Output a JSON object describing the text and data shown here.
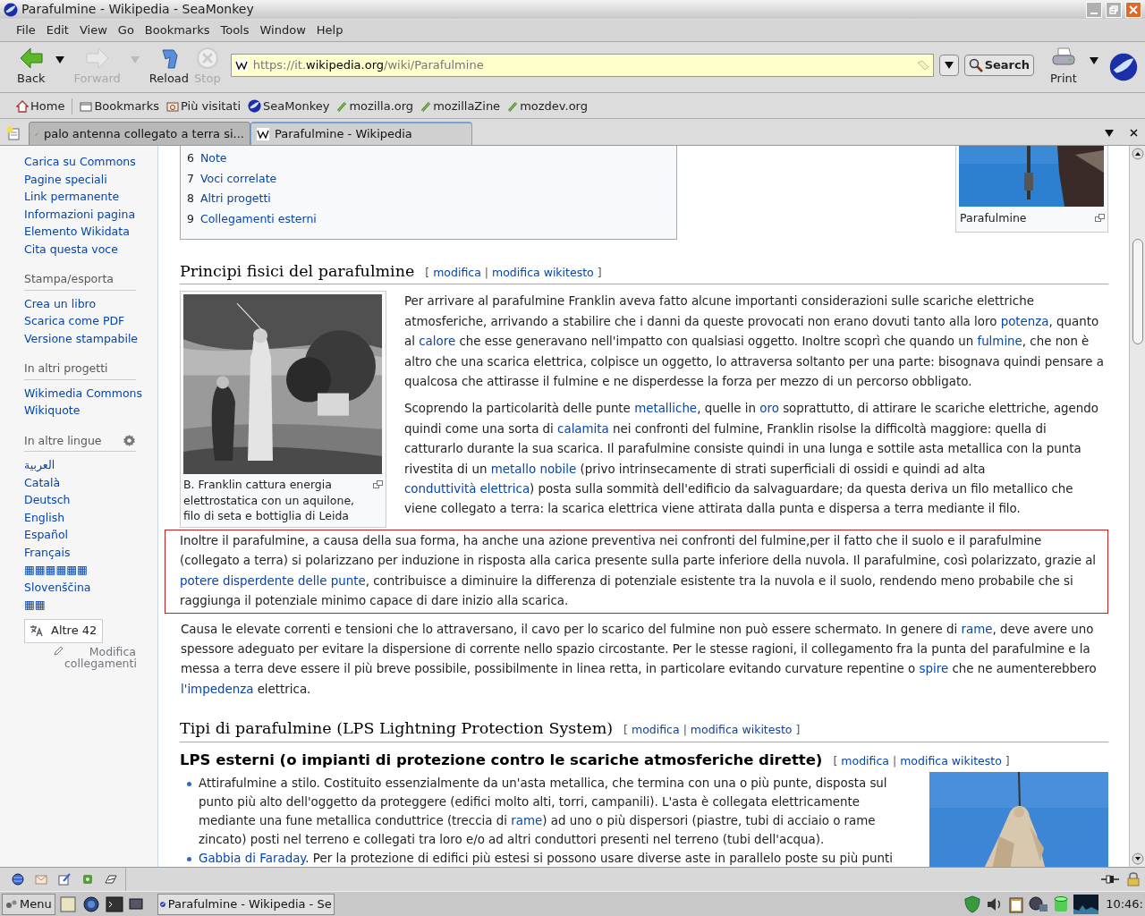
{
  "window": {
    "title": "Parafulmine - Wikipedia - SeaMonkey"
  },
  "menu": [
    "File",
    "Edit",
    "View",
    "Go",
    "Bookmarks",
    "Tools",
    "Window",
    "Help"
  ],
  "nav_buttons": [
    {
      "kind": "back",
      "label": "Back",
      "disabled": false
    },
    {
      "kind": "forward",
      "label": "Forward",
      "disabled": true
    },
    {
      "kind": "reload",
      "label": "Reload",
      "disabled": false
    },
    {
      "kind": "stop",
      "label": "Stop",
      "disabled": true
    }
  ],
  "url": [
    {
      "text": "https://it.",
      "highlight": false
    },
    {
      "text": "wikipedia.org",
      "highlight": true
    },
    {
      "text": "/wiki/Parafulmine",
      "highlight": false
    }
  ],
  "search_button": "Search",
  "print_button": "Print",
  "bookmarks": [
    {
      "kind": "home",
      "label": "Home"
    },
    {
      "kind": "folder",
      "label": "Bookmarks"
    },
    {
      "kind": "folder2",
      "label": "Più visitati"
    },
    {
      "kind": "seamonkey",
      "label": "SeaMonkey"
    },
    {
      "kind": "link",
      "label": "mozilla.org"
    },
    {
      "kind": "link",
      "label": "mozillaZine"
    },
    {
      "kind": "link",
      "label": "mozdev.org"
    }
  ],
  "tabs": [
    {
      "label": "palo antenna collegato a terra si...",
      "kind": "link",
      "selected": false
    },
    {
      "label": "Parafulmine - Wikipedia",
      "kind": "wiki",
      "selected": true
    }
  ],
  "sidebar": {
    "links": [
      "Carica su Commons",
      "Pagine speciali",
      "Link permanente",
      "Informazioni pagina",
      "Elemento Wikidata",
      "Cita questa voce"
    ],
    "sections": [
      {
        "heading": "Stampa/esporta",
        "settings": false,
        "items": [
          "Crea un libro",
          "Scarica come PDF",
          "Versione stampabile"
        ]
      },
      {
        "heading": "In altri progetti",
        "settings": false,
        "items": [
          "Wikimedia Commons",
          "Wikiquote"
        ]
      },
      {
        "heading": "In altre lingue",
        "settings": true,
        "items": [
          "العربية",
          "Català",
          "Deutsch",
          "English",
          "Español",
          "Français",
          "▦▦▦▦▦▦",
          "Slovenščina",
          "▦▦"
        ]
      }
    ],
    "more_languages": "Altre 42",
    "edit_links": "Modifica collegamenti"
  },
  "toc": [
    {
      "number": "6",
      "label": "Note"
    },
    {
      "number": "7",
      "label": "Voci correlate"
    },
    {
      "number": "8",
      "label": "Altri progetti"
    },
    {
      "number": "9",
      "label": "Collegamenti esterni"
    }
  ],
  "top_figure": {
    "kind": "picture",
    "caption": "Parafulmine"
  },
  "sections": [
    {
      "heading": "Principi fisici del parafulmine",
      "kind": "h2",
      "edit": [
        "[",
        "modifica",
        "|",
        "modifica wikitesto",
        "]"
      ],
      "figure": {
        "kind": "picture",
        "caption": "B. Franklin cattura energia elettrostatica con un aquilone, filo di seta e bottiglia di Leida"
      },
      "paragraphs": [
        {
          "highlighted": false,
          "parts": [
            {
              "text": "Per arrivare al parafulmine Franklin aveva fatto alcune importanti considerazioni sulle scariche elettriche atmosferiche, arrivando a stabilire che i danni da queste provocati non erano dovuti tanto alla loro ",
              "kind": "text"
            },
            {
              "text": "potenza",
              "kind": "link"
            },
            {
              "text": ", quanto al ",
              "kind": "text"
            },
            {
              "text": "calore",
              "kind": "link"
            },
            {
              "text": " che esse generavano nell'impatto con qualsiasi oggetto. Inoltre scoprì che quando un ",
              "kind": "text"
            },
            {
              "text": "fulmine",
              "kind": "link"
            },
            {
              "text": ", che non è altro che una scarica elettrica, colpisce un oggetto, lo attraversa soltanto per una parte: bisognava quindi pensare a qualcosa che attirasse il fulmine e ne disperdesse la forza per mezzo di un percorso obbligato.",
              "kind": "text"
            }
          ]
        },
        {
          "highlighted": false,
          "parts": [
            {
              "text": "Scoprendo la particolarità delle punte ",
              "kind": "text"
            },
            {
              "text": "metalliche",
              "kind": "link"
            },
            {
              "text": ", quelle in ",
              "kind": "text"
            },
            {
              "text": "oro",
              "kind": "link"
            },
            {
              "text": " soprattutto, di attirare le scariche elettriche, agendo quindi come una sorta di ",
              "kind": "text"
            },
            {
              "text": "calamita",
              "kind": "link"
            },
            {
              "text": " nei confronti del fulmine, Franklin risolse la difficoltà maggiore: quella di catturarlo durante la sua scarica. Il parafulmine consiste quindi in una lunga e sottile asta metallica con la punta rivestita di un ",
              "kind": "text"
            },
            {
              "text": "metallo nobile",
              "kind": "link"
            },
            {
              "text": " (privo intrinsecamente di strati superficiali di ossidi e quindi ad alta ",
              "kind": "text"
            },
            {
              "text": "conduttività elettrica",
              "kind": "link"
            },
            {
              "text": ") posta sulla sommità dell'edificio da salvaguardare; da questa deriva un filo metallico che viene collegato a terra: la scarica elettrica viene attirata dalla punta e dispersa a terra mediante il filo.",
              "kind": "text"
            }
          ]
        },
        {
          "highlighted": true,
          "parts": [
            {
              "text": "Inoltre il parafulmine, a causa della sua forma, ha anche una azione preventiva nei confronti del fulmine,per il fatto che il suolo e il parafulmine (collegato a terra) si polarizzano per induzione in risposta alla carica presente sulla parte inferiore della nuvola. Il parafulmine, così polarizzato, grazie al ",
              "kind": "text"
            },
            {
              "text": "potere disperdente delle punte",
              "kind": "link"
            },
            {
              "text": ", contribuisce a diminuire la differenza di potenziale esistente tra la nuvola e il suolo, rendendo meno probabile che si raggiunga il potenziale minimo capace di dare inizio alla scarica.",
              "kind": "text"
            }
          ]
        },
        {
          "highlighted": false,
          "parts": [
            {
              "text": "Causa le elevate correnti e tensioni che lo attraversano, il cavo per lo scarico del fulmine non può essere schermato. In genere di ",
              "kind": "text"
            },
            {
              "text": "rame",
              "kind": "link"
            },
            {
              "text": ", deve avere uno spessore adeguato per evitare la dispersione di corrente nello spazio circostante. Per le stesse ragioni, il collegamento fra la punta del parafulmine e la messa a terra deve essere il più breve possibile, possibilmente in linea retta, in particolare evitando curvature repentine o ",
              "kind": "text"
            },
            {
              "text": "spire",
              "kind": "link"
            },
            {
              "text": " che ne aumenterebbero ",
              "kind": "text"
            },
            {
              "text": "l'impedenza",
              "kind": "link"
            },
            {
              "text": " elettrica.",
              "kind": "text"
            }
          ]
        }
      ]
    },
    {
      "heading": "Tipi di parafulmine (LPS Lightning Protection System)",
      "kind": "h2",
      "edit": [
        "[",
        "modifica",
        "|",
        "modifica wikitesto",
        "]"
      ]
    },
    {
      "heading": "LPS esterni (o impianti di protezione contro le scariche atmosferiche dirette)",
      "kind": "h3",
      "edit": [
        "[",
        "modifica",
        "|",
        "modifica wikitesto",
        "]"
      ],
      "figure": {
        "kind": "picture"
      },
      "list": [
        [
          {
            "text": "Attirafulmine a stilo. Costituito essenzialmente da un'asta metallica, che termina con una o più punte, disposta sul punto più alto dell'oggetto da proteggere (edifici molto alti, torri, campanili). L'asta è collegata elettricamente mediante una fune metallica conduttrice (treccia di ",
            "kind": "text"
          },
          {
            "text": "rame",
            "kind": "link"
          },
          {
            "text": ") ad uno o più dispersori (piastre, tubi di acciaio o rame zincato) posti nel terreno e collegati tra loro e/o ad altri conduttori presenti nel terreno (tubi dell'acqua).",
            "kind": "text"
          }
        ],
        [
          {
            "text": "Gabbia di Faraday",
            "kind": "link"
          },
          {
            "text": ". Per la protezione di edifici più estesi si possono usare diverse aste in parallelo poste su più punti",
            "kind": "text"
          }
        ]
      ]
    }
  ],
  "taskbar": {
    "menu": "Menu",
    "window": "Parafulmine - Wikipedia - Se",
    "clock": "10:46:"
  }
}
